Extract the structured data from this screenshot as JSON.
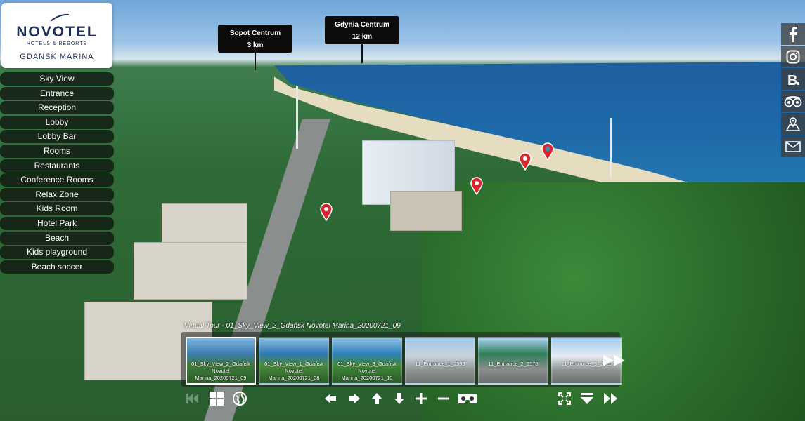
{
  "logo": {
    "brand": "NOVOTEL",
    "subtitle": "HOTELS & RESORTS",
    "location": "GDANSK MARINA"
  },
  "menu": {
    "items": [
      {
        "label": "Sky View"
      },
      {
        "label": "Entrance"
      },
      {
        "label": "Reception"
      },
      {
        "label": "Lobby"
      },
      {
        "label": "Lobby Bar"
      },
      {
        "label": "Rooms"
      },
      {
        "label": "Restaurants"
      },
      {
        "label": "Conference Rooms"
      },
      {
        "label": "Relax Zone"
      },
      {
        "label": "Kids Room"
      },
      {
        "label": "Hotel Park"
      },
      {
        "label": "Beach"
      },
      {
        "label": "Kids playground"
      },
      {
        "label": "Beach soccer"
      }
    ]
  },
  "tags": [
    {
      "name": "Sopot Centrum",
      "distance": "3 km"
    },
    {
      "name": "Gdynia Centrum",
      "distance": "12 km"
    }
  ],
  "social": [
    "facebook-icon",
    "instagram-icon",
    "booking-icon",
    "tripadvisor-icon",
    "map-icon",
    "mail-icon"
  ],
  "tour": {
    "caption": "Virtual Tour - 01_Sky_View_2_Gdańsk Novotel Marina_20200721_09",
    "thumbnails": [
      {
        "label": "01_Sky_View_2_Gdańsk Novotel Marina_20200721_09",
        "active": true
      },
      {
        "label": "01_Sky_View_1_Gdańsk Novotel Marina_20200721_08",
        "active": false
      },
      {
        "label": "01_Sky_View_3_Gdańsk Novotel Marina_20200721_10",
        "active": false
      },
      {
        "label": "11_Entrance_1_2593",
        "active": false
      },
      {
        "label": "11_Entrance_2_2578",
        "active": false
      },
      {
        "label": "11_Entrance_3_2611",
        "active": false
      }
    ]
  },
  "colors": {
    "brand": "#1e2f5e",
    "pin": "#d9262c",
    "menu_bg": "#0f140f"
  }
}
